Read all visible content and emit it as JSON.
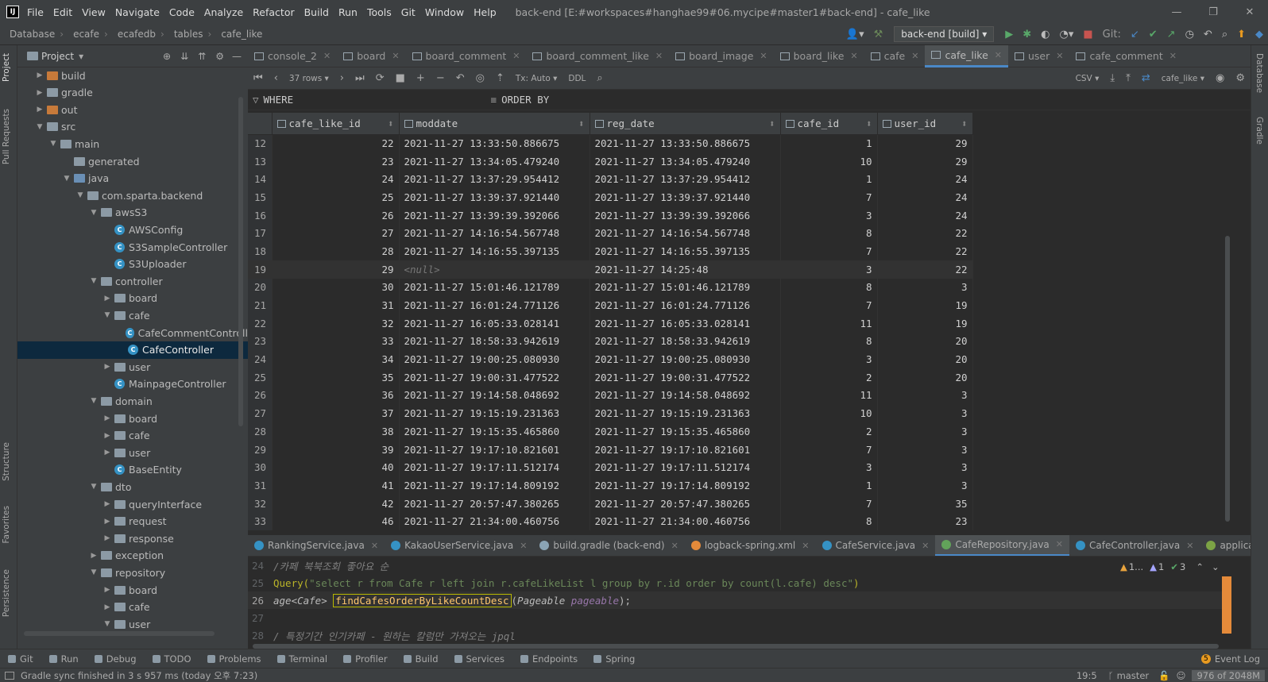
{
  "window": {
    "title": "back-end [E:#workspaces#hanghae99#06.mycipe#master1#back-end] - cafe_like",
    "menu": [
      "File",
      "Edit",
      "View",
      "Navigate",
      "Code",
      "Analyze",
      "Refactor",
      "Build",
      "Run",
      "Tools",
      "Git",
      "Window",
      "Help"
    ]
  },
  "breadcrumb": [
    "Database",
    "ecafe",
    "ecafedb",
    "tables",
    "cafe_like"
  ],
  "run_config": "back-end [build]",
  "git_label": "Git:",
  "left_strip": [
    "Project",
    "Pull Requests",
    "Structure",
    "Favorites",
    "Persistence"
  ],
  "right_strip": [
    "Database",
    "Gradle"
  ],
  "project": {
    "header": "Project",
    "tree": [
      {
        "label": "build",
        "depth": 1,
        "kind": "folder-orange",
        "arrow": "right"
      },
      {
        "label": "gradle",
        "depth": 1,
        "kind": "folder",
        "arrow": "right"
      },
      {
        "label": "out",
        "depth": 1,
        "kind": "folder-orange",
        "arrow": "right"
      },
      {
        "label": "src",
        "depth": 1,
        "kind": "folder",
        "arrow": "down"
      },
      {
        "label": "main",
        "depth": 2,
        "kind": "folder",
        "arrow": "down"
      },
      {
        "label": "generated",
        "depth": 3,
        "kind": "folder",
        "arrow": ""
      },
      {
        "label": "java",
        "depth": 3,
        "kind": "folder-blue",
        "arrow": "down"
      },
      {
        "label": "com.sparta.backend",
        "depth": 4,
        "kind": "folder",
        "arrow": "down"
      },
      {
        "label": "awsS3",
        "depth": 5,
        "kind": "folder",
        "arrow": "down"
      },
      {
        "label": "AWSConfig",
        "depth": 6,
        "kind": "class",
        "arrow": ""
      },
      {
        "label": "S3SampleController",
        "depth": 6,
        "kind": "class",
        "arrow": ""
      },
      {
        "label": "S3Uploader",
        "depth": 6,
        "kind": "class",
        "arrow": ""
      },
      {
        "label": "controller",
        "depth": 5,
        "kind": "folder",
        "arrow": "down"
      },
      {
        "label": "board",
        "depth": 6,
        "kind": "folder",
        "arrow": "right"
      },
      {
        "label": "cafe",
        "depth": 6,
        "kind": "folder",
        "arrow": "down"
      },
      {
        "label": "CafeCommentControll",
        "depth": 7,
        "kind": "class",
        "arrow": ""
      },
      {
        "label": "CafeController",
        "depth": 7,
        "kind": "class",
        "arrow": "",
        "selected": true
      },
      {
        "label": "user",
        "depth": 6,
        "kind": "folder",
        "arrow": "right"
      },
      {
        "label": "MainpageController",
        "depth": 6,
        "kind": "class",
        "arrow": ""
      },
      {
        "label": "domain",
        "depth": 5,
        "kind": "folder",
        "arrow": "down"
      },
      {
        "label": "board",
        "depth": 6,
        "kind": "folder",
        "arrow": "right"
      },
      {
        "label": "cafe",
        "depth": 6,
        "kind": "folder",
        "arrow": "right"
      },
      {
        "label": "user",
        "depth": 6,
        "kind": "folder",
        "arrow": "right"
      },
      {
        "label": "BaseEntity",
        "depth": 6,
        "kind": "class",
        "arrow": ""
      },
      {
        "label": "dto",
        "depth": 5,
        "kind": "folder",
        "arrow": "down"
      },
      {
        "label": "queryInterface",
        "depth": 6,
        "kind": "folder",
        "arrow": "right"
      },
      {
        "label": "request",
        "depth": 6,
        "kind": "folder",
        "arrow": "right"
      },
      {
        "label": "response",
        "depth": 6,
        "kind": "folder",
        "arrow": "right"
      },
      {
        "label": "exception",
        "depth": 5,
        "kind": "folder",
        "arrow": "right"
      },
      {
        "label": "repository",
        "depth": 5,
        "kind": "folder",
        "arrow": "down"
      },
      {
        "label": "board",
        "depth": 6,
        "kind": "folder",
        "arrow": "right"
      },
      {
        "label": "cafe",
        "depth": 6,
        "kind": "folder",
        "arrow": "right"
      },
      {
        "label": "user",
        "depth": 6,
        "kind": "folder",
        "arrow": "down"
      }
    ]
  },
  "editor_tabs": [
    {
      "label": "console_2",
      "active": false
    },
    {
      "label": "board",
      "active": false
    },
    {
      "label": "board_comment",
      "active": false
    },
    {
      "label": "board_comment_like",
      "active": false
    },
    {
      "label": "board_image",
      "active": false
    },
    {
      "label": "board_like",
      "active": false
    },
    {
      "label": "cafe",
      "active": false
    },
    {
      "label": "cafe_like",
      "active": true
    },
    {
      "label": "user",
      "active": false
    },
    {
      "label": "cafe_comment",
      "active": false
    }
  ],
  "grid_toolbar": {
    "rows": "37 rows",
    "tx": "Tx: Auto",
    "ddl": "DDL",
    "export": "CSV",
    "table_ref": "cafe_like"
  },
  "filter": {
    "where": "WHERE",
    "order_by": "ORDER BY"
  },
  "columns": [
    "cafe_like_id",
    "moddate",
    "reg_date",
    "cafe_id",
    "user_id"
  ],
  "rows": [
    [
      "12",
      "22",
      "2021-11-27 13:33:50.886675",
      "2021-11-27 13:33:50.886675",
      "1",
      "29"
    ],
    [
      "13",
      "23",
      "2021-11-27 13:34:05.479240",
      "2021-11-27 13:34:05.479240",
      "10",
      "29"
    ],
    [
      "14",
      "24",
      "2021-11-27 13:37:29.954412",
      "2021-11-27 13:37:29.954412",
      "1",
      "24"
    ],
    [
      "15",
      "25",
      "2021-11-27 13:39:37.921440",
      "2021-11-27 13:39:37.921440",
      "7",
      "24"
    ],
    [
      "16",
      "26",
      "2021-11-27 13:39:39.392066",
      "2021-11-27 13:39:39.392066",
      "3",
      "24"
    ],
    [
      "17",
      "27",
      "2021-11-27 14:16:54.567748",
      "2021-11-27 14:16:54.567748",
      "8",
      "22"
    ],
    [
      "18",
      "28",
      "2021-11-27 14:16:55.397135",
      "2021-11-27 14:16:55.397135",
      "7",
      "22"
    ],
    [
      "19",
      "29",
      "<null>",
      "2021-11-27 14:25:48",
      "3",
      "22"
    ],
    [
      "20",
      "30",
      "2021-11-27 15:01:46.121789",
      "2021-11-27 15:01:46.121789",
      "8",
      "3"
    ],
    [
      "21",
      "31",
      "2021-11-27 16:01:24.771126",
      "2021-11-27 16:01:24.771126",
      "7",
      "19"
    ],
    [
      "22",
      "32",
      "2021-11-27 16:05:33.028141",
      "2021-11-27 16:05:33.028141",
      "11",
      "19"
    ],
    [
      "23",
      "33",
      "2021-11-27 18:58:33.942619",
      "2021-11-27 18:58:33.942619",
      "8",
      "20"
    ],
    [
      "24",
      "34",
      "2021-11-27 19:00:25.080930",
      "2021-11-27 19:00:25.080930",
      "3",
      "20"
    ],
    [
      "25",
      "35",
      "2021-11-27 19:00:31.477522",
      "2021-11-27 19:00:31.477522",
      "2",
      "20"
    ],
    [
      "26",
      "36",
      "2021-11-27 19:14:58.048692",
      "2021-11-27 19:14:58.048692",
      "11",
      "3"
    ],
    [
      "27",
      "37",
      "2021-11-27 19:15:19.231363",
      "2021-11-27 19:15:19.231363",
      "10",
      "3"
    ],
    [
      "28",
      "38",
      "2021-11-27 19:15:35.465860",
      "2021-11-27 19:15:35.465860",
      "2",
      "3"
    ],
    [
      "29",
      "39",
      "2021-11-27 19:17:10.821601",
      "2021-11-27 19:17:10.821601",
      "7",
      "3"
    ],
    [
      "30",
      "40",
      "2021-11-27 19:17:11.512174",
      "2021-11-27 19:17:11.512174",
      "3",
      "3"
    ],
    [
      "31",
      "41",
      "2021-11-27 19:17:14.809192",
      "2021-11-27 19:17:14.809192",
      "1",
      "3"
    ],
    [
      "32",
      "42",
      "2021-11-27 20:57:47.380265",
      "2021-11-27 20:57:47.380265",
      "7",
      "35"
    ],
    [
      "33",
      "46",
      "2021-11-27 21:34:00.460756",
      "2021-11-27 21:34:00.460756",
      "8",
      "23"
    ]
  ],
  "file_tabs": [
    {
      "label": "RankingService.java",
      "active": false,
      "color": "#3592c4"
    },
    {
      "label": "KakaoUserService.java",
      "active": false,
      "color": "#3592c4"
    },
    {
      "label": "build.gradle (back-end)",
      "active": false,
      "color": "#8aa4b5"
    },
    {
      "label": "logback-spring.xml",
      "active": false,
      "color": "#e48a3a"
    },
    {
      "label": "CafeService.java",
      "active": false,
      "color": "#3592c4"
    },
    {
      "label": "CafeRepository.java",
      "active": true,
      "color": "#62a35a"
    },
    {
      "label": "CafeController.java",
      "active": false,
      "color": "#3592c4"
    },
    {
      "label": "application.properties",
      "active": false,
      "color": "#7ca345"
    }
  ],
  "inspections": {
    "warn1": "1...",
    "warn2": "1",
    "ok": "3"
  },
  "code": {
    "l24": {
      "num": "24",
      "text": "/카페 북북조회 좋아요 순"
    },
    "l25": {
      "num": "25",
      "anno": "Query(",
      "str": "\"select r from Cafe r left join r.cafeLikeList l group by r.id order by count(l.cafe) desc\"",
      "close": ")"
    },
    "l26": {
      "num": "26",
      "type": "age<Cafe>",
      "fn": "findCafesOrderByLikeCountDesc",
      "param_type": "Pageable",
      "param": "pageable",
      "end": ");"
    },
    "l27": {
      "num": "27"
    },
    "l28": {
      "num": "28",
      "text": "/   특정기간 인기카페 - 원하는 칼럼만 가져오는 jpql"
    }
  },
  "tool_windows": [
    "Git",
    "Run",
    "Debug",
    "TODO",
    "Problems",
    "Terminal",
    "Profiler",
    "Build",
    "Services",
    "Endpoints",
    "Spring"
  ],
  "event_log": "Event Log",
  "status": {
    "message": "Gradle sync finished in 3 s 957 ms (today 오후 7:23)",
    "position": "19:5",
    "branch": "master",
    "memory": "976 of 2048M"
  }
}
